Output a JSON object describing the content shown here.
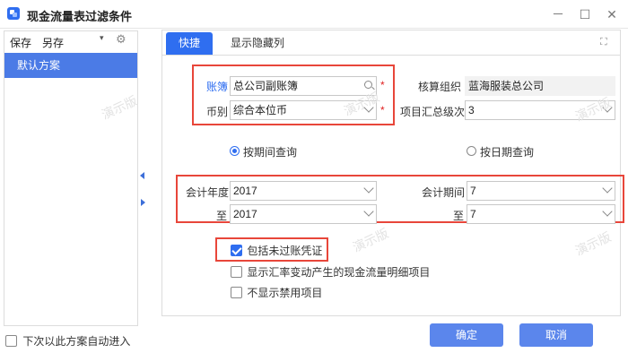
{
  "window": {
    "title": "现金流量表过滤条件",
    "minimize": "－",
    "maximize": "☐",
    "close": "✕"
  },
  "left": {
    "save": "保存",
    "save_as": "另存",
    "scheme": "默认方案",
    "auto_enter": "下次以此方案自动进入"
  },
  "tabs": [
    "快捷",
    "显示隐藏列"
  ],
  "form": {
    "ledger_label": "账簿",
    "ledger_value": "总公司副账簿",
    "currency_label": "币别",
    "currency_value": "综合本位币",
    "org_label": "核算组织",
    "org_value": "蓝海服装总公司",
    "summary_label": "项目汇总级次",
    "summary_value": "3",
    "required": "*",
    "radio_period": "按期间查询",
    "radio_date": "按日期查询",
    "year_label": "会计年度",
    "year_from": "2017",
    "to_label": "至",
    "year_to": "2017",
    "period_label": "会计期间",
    "period_from": "7",
    "period_to": "7"
  },
  "checks": [
    {
      "label": "包括未过账凭证",
      "checked": true
    },
    {
      "label": "显示汇率变动产生的现金流量明细项目",
      "checked": false
    },
    {
      "label": "不显示禁用项目",
      "checked": false
    }
  ],
  "buttons": {
    "ok": "确定",
    "cancel": "取消"
  },
  "watermark": "演示版",
  "colors": {
    "accent": "#2f6ef0",
    "highlight": "#e8463a",
    "button": "#5b86ec"
  }
}
